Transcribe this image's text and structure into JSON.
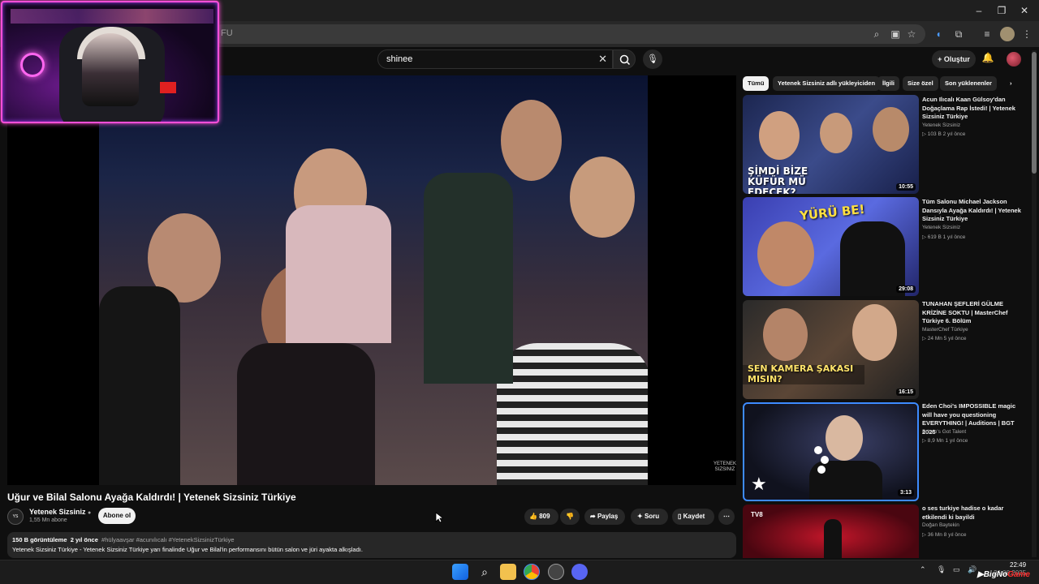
{
  "browser": {
    "url_fragment": "FU",
    "window_controls": [
      "minimize-icon",
      "restore-icon",
      "close-icon"
    ]
  },
  "header": {
    "search_query": "shinee",
    "create_label": "Oluştur"
  },
  "video": {
    "title": "Uğur ve Bilal Salonu Ayağa Kaldırdı! | Yetenek Sizsiniz Türkiye",
    "channel": "Yetenek Sizsiniz",
    "subscribers": "1,55 Mn abone",
    "subscribe_label": "Abone ol",
    "likes": "809",
    "share_label": "Paylaş",
    "ask_label": "Soru",
    "save_label": "Kaydet",
    "views": "150 B görüntüleme",
    "age": "2 yıl önce",
    "tags": "#hülyaavşar #acunılıcalı #YetenekSizsinizTürkiye",
    "description": "Yetenek Sizsiniz Türkiye -  Yetenek Sizsiniz Türkiye yarı finalinde Uğur ve Bilal'in performansını bütün salon ve jüri ayakta alkışladı."
  },
  "chips": [
    "Tümü",
    "Yetenek Sizsiniz adlı yükleyiciden",
    "İlgili",
    "Size özel",
    "Son yüklenenler"
  ],
  "recommendations": [
    {
      "title": "Acun Ilıcalı Kaan Gülsoy'dan Doğaçlama Rap İstedi! | Yetenek Sizsiniz Türkiye",
      "channel": "Yetenek Sizsiniz",
      "meta": "▷ 103 B   2 yıl önce",
      "duration": "10:55",
      "thumb_text": "ŞİMDİ BİZE KÜFÜR MÜ EDECEK?"
    },
    {
      "title": "Tüm Salonu Michael Jackson Dansıyla Ayağa Kaldırdı! | Yetenek Sizsiniz Türkiye",
      "channel": "Yetenek Sizsiniz",
      "meta": "▷ 619 B   1 yıl önce",
      "duration": "29:08",
      "thumb_text": "YÜRÜ BE!"
    },
    {
      "title": "TUNAHAN ŞEFLERİ GÜLME KRİZİNE SOKTU | MasterChef Türkiye 6. Bölüm",
      "channel": "MasterChef Türkiye",
      "meta": "▷ 24 Mn   5 yıl önce",
      "duration": "16:15",
      "thumb_text": "SEN KAMERA ŞAKASI MISIN?"
    },
    {
      "title": "Eden Choi's IMPOSSIBLE magic will have you questioning EVERYTHING! | Auditions | BGT 2025",
      "channel": "Britain's Got Talent",
      "meta": "▷ 8,9 Mn   1 yıl önce",
      "duration": "3:13",
      "thumb_text": ""
    },
    {
      "title": "o ses turkiye  hadise o kadar etkilendi ki bayildi",
      "channel": "Doğan Baytekin",
      "meta": "▷ 36 Mn   8 yıl önce",
      "duration": "",
      "thumb_text": ""
    }
  ],
  "taskbar": {
    "time": "22:49",
    "date": "26.08.2025",
    "watermark_a": "BigNo",
    "watermark_b": "Game"
  },
  "colors": {
    "background": "#0f0f0f",
    "webcam_border": "#ff4fd8",
    "accent_red": "#ff0000"
  }
}
